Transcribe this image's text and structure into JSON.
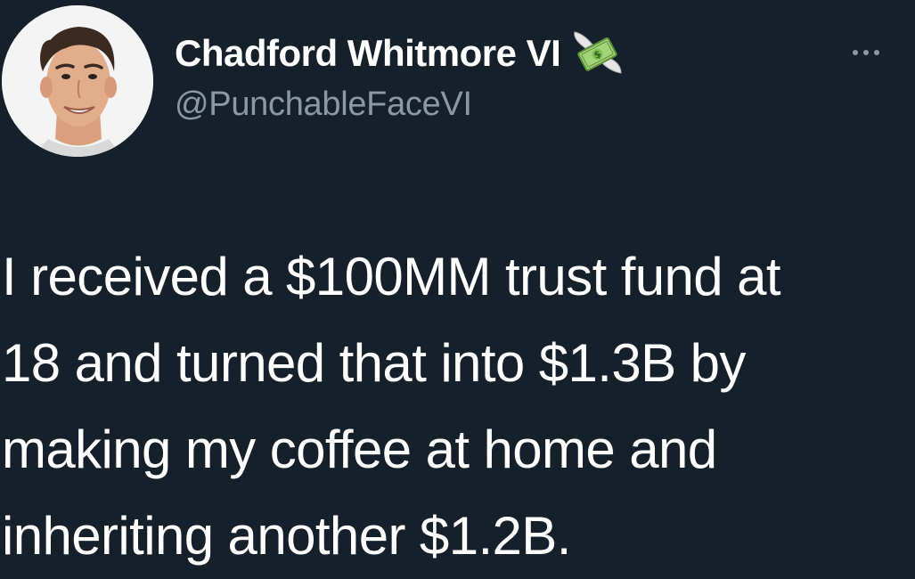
{
  "tweet": {
    "author": {
      "display_name": "Chadford Whitmore VI",
      "handle": "@PunchableFaceVI",
      "badge_icon": "money-with-wings-icon",
      "avatar": "profile-photo"
    },
    "more_icon": "more-horizontal-icon",
    "text_lines": [
      "I received a $100MM trust fund at",
      "18 and turned that into $1.3B by",
      "making my coffee at home and",
      "inheriting another $1.2B."
    ]
  },
  "colors": {
    "background": "#15202b",
    "text_primary": "#ffffff",
    "text_secondary": "#8b98a5"
  }
}
